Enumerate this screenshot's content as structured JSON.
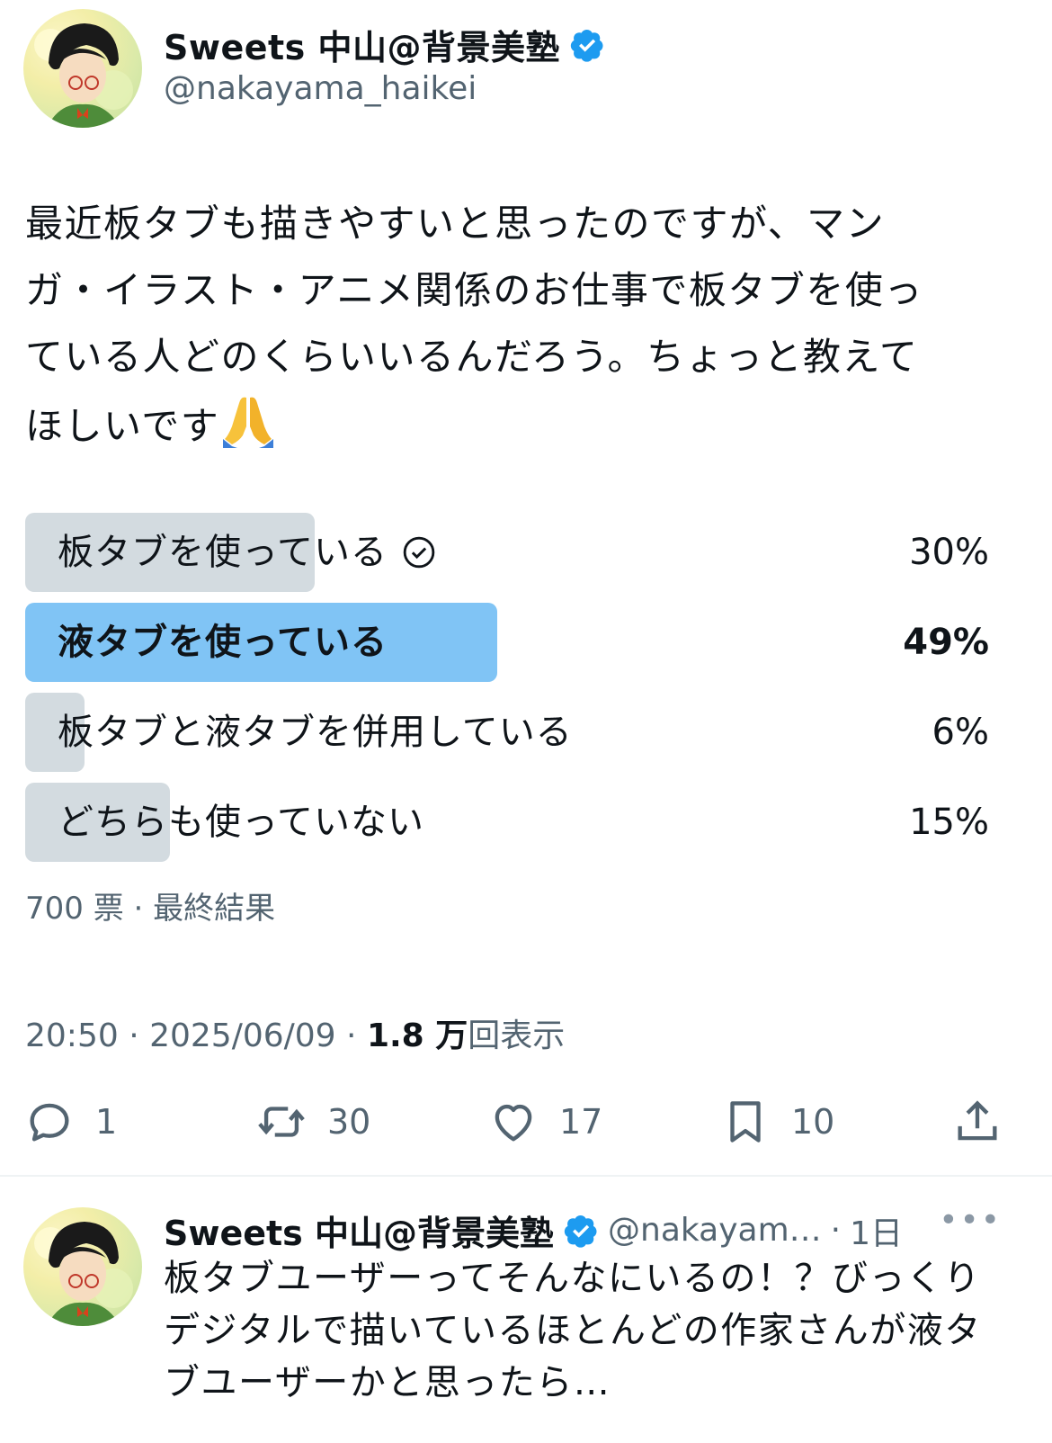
{
  "tweet": {
    "author": {
      "display_name": "Sweets 中山@背景美塾",
      "handle": "@nakayama_haikei",
      "verified": true
    },
    "text_lines": [
      "最近板タブも描きやすいと思ったのですが、マン",
      "ガ・イラスト・アニメ関係のお仕事で板タブを使っ",
      "ている人どのくらいいるんだろう。ちょっと教えて",
      "ほしいです"
    ],
    "emoji": "folded-hands",
    "poll": {
      "options": [
        {
          "label": "板タブを使っている",
          "percent": "30%",
          "fraction": 0.3,
          "voted": true,
          "winner": false
        },
        {
          "label": "液タブを使っている",
          "percent": "49%",
          "fraction": 0.49,
          "voted": false,
          "winner": true
        },
        {
          "label": "板タブと液タブを併用している",
          "percent": "6%",
          "fraction": 0.06,
          "voted": false,
          "winner": false
        },
        {
          "label": "どちらも使っていない",
          "percent": "15%",
          "fraction": 0.15,
          "voted": false,
          "winner": false
        }
      ],
      "votes": "700 票",
      "status": "最終結果"
    },
    "time": "20:50",
    "date": "2025/06/09",
    "views_count": "1.8 万",
    "views_label": "回表示",
    "actions": {
      "replies": "1",
      "retweets": "30",
      "likes": "17",
      "bookmarks": "10"
    }
  },
  "reply": {
    "display_name": "Sweets 中山@背景美塾",
    "handle": "@nakayam…",
    "age": "1日",
    "more": "•••",
    "text_lines": [
      "板タブユーザーってそんなにいるの！？びっくり",
      "デジタルで描いているほとんどの作家さんが液タ",
      "ブユーザーかと思ったら…"
    ]
  },
  "colors": {
    "verified": "#1d9bf0",
    "poll_winner": "#80c4f5",
    "poll_other": "#d3dbe0",
    "muted": "#536471"
  }
}
